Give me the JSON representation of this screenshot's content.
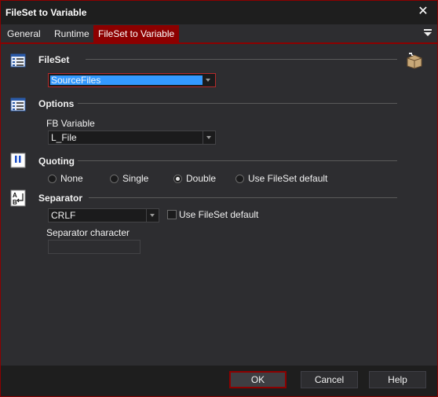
{
  "window": {
    "title": "FileSet to Variable"
  },
  "tabs": [
    {
      "label": "General"
    },
    {
      "label": "Runtime"
    },
    {
      "label": "FileSet to Variable"
    }
  ],
  "active_tab": "FileSet to Variable",
  "fileset": {
    "title": "FileSet",
    "value": "SourceFiles"
  },
  "options": {
    "title": "Options",
    "fb_variable_label": "FB Variable",
    "fb_variable_value": "L_File"
  },
  "quoting": {
    "title": "Quoting",
    "options": [
      {
        "label": "None",
        "checked": false
      },
      {
        "label": "Single",
        "checked": false
      },
      {
        "label": "Double",
        "checked": true
      },
      {
        "label": "Use FileSet default",
        "checked": false
      }
    ]
  },
  "separator": {
    "title": "Separator",
    "value": "CRLF",
    "use_default_label": "Use FileSet default",
    "use_default_checked": false,
    "character_label": "Separator character",
    "character_value": ""
  },
  "buttons": {
    "ok": "OK",
    "cancel": "Cancel",
    "help": "Help"
  },
  "icons": {
    "close": "close-icon",
    "tab_menu": "menu-icon",
    "fileset": "list-icon",
    "options": "list-icon",
    "quoting": "quote-icon",
    "separator": "separator-icon",
    "browse": "box-icon"
  },
  "colors": {
    "accent": "#8c0000",
    "selection": "#3399ff",
    "background": "#2d2d30"
  }
}
